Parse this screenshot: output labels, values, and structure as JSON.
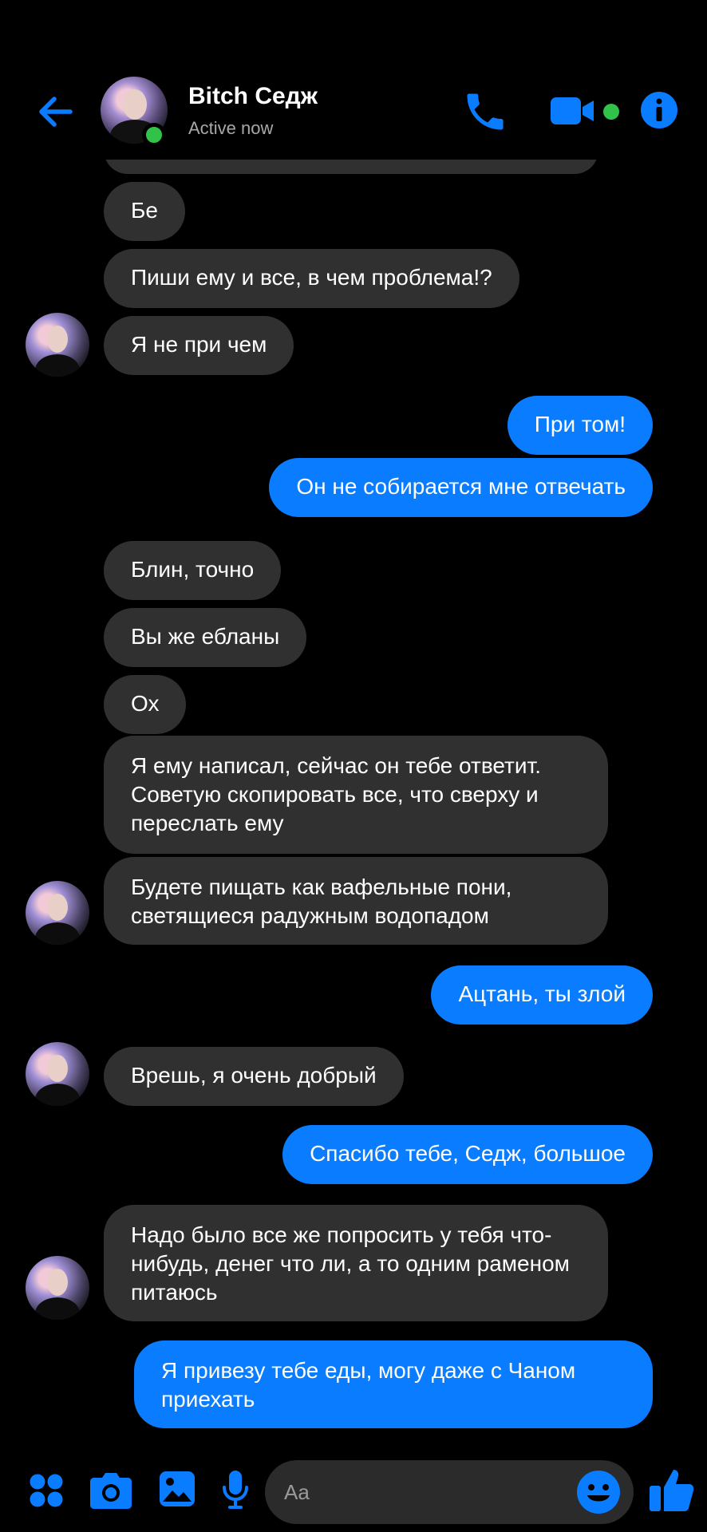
{
  "header": {
    "contact_name": "Bitch Седж",
    "status": "Active now"
  },
  "messages": [
    {
      "from": "them",
      "text": "Бе"
    },
    {
      "from": "them",
      "text": "Пиши ему и все, в чем проблема!?"
    },
    {
      "from": "them",
      "text": "Я не при чем"
    },
    {
      "from": "me",
      "text": "При том!"
    },
    {
      "from": "me",
      "text": "Он не собирается мне отвечать"
    },
    {
      "from": "them",
      "text": "Блин, точно"
    },
    {
      "from": "them",
      "text": "Вы же ебланы"
    },
    {
      "from": "them",
      "text": "Ох"
    },
    {
      "from": "them",
      "text": "Я ему написал, сейчас он тебе ответит. Советую скопировать все, что сверху и переслать ему"
    },
    {
      "from": "them",
      "text": "Будете пищать как вафельные пони, светящиеся радужным водопадом"
    },
    {
      "from": "me",
      "text": "Ацтань, ты злой"
    },
    {
      "from": "them",
      "text": "Врешь, я очень добрый"
    },
    {
      "from": "me",
      "text": "Спасибо тебе, Седж, большое"
    },
    {
      "from": "them",
      "text": "Надо было все же попросить у тебя что-нибудь, денег что ли, а то одним раменом питаюсь"
    },
    {
      "from": "me",
      "text": "Я привезу тебе еды, могу даже с Чаном приехать"
    }
  ],
  "composer": {
    "placeholder": "Aa"
  },
  "icons": {
    "back": "arrow-left-icon",
    "call": "phone-icon",
    "video": "video-camera-icon",
    "info": "info-icon",
    "apps": "grid-icon",
    "camera": "camera-icon",
    "gallery": "image-icon",
    "mic": "microphone-icon",
    "emoji": "smiley-icon",
    "like": "thumbs-up-icon"
  },
  "colors": {
    "accent": "#0a7cff",
    "incoming_bubble": "#303030",
    "online": "#31c24a"
  }
}
